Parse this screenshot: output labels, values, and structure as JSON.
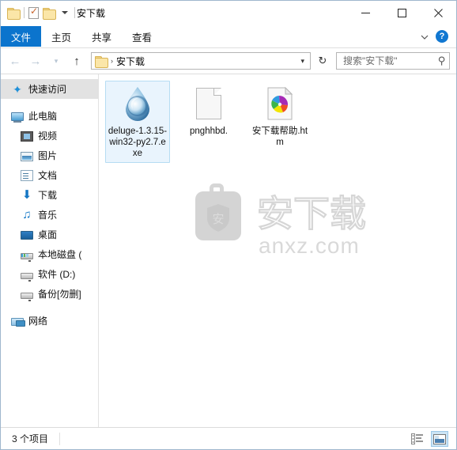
{
  "window": {
    "title": "安下载",
    "quick_access": [
      {
        "name": "folder-icon",
        "label": ""
      },
      {
        "name": "properties-icon",
        "label": ""
      },
      {
        "name": "folder-icon",
        "label": ""
      }
    ],
    "controls": {
      "minimize": "─",
      "maximize": "□",
      "close": "✕"
    }
  },
  "ribbon": {
    "tabs": [
      {
        "label": "文件",
        "active": true
      },
      {
        "label": "主页",
        "active": false
      },
      {
        "label": "共享",
        "active": false
      },
      {
        "label": "查看",
        "active": false
      }
    ],
    "expand_icon": "chevron-down-icon",
    "help_label": "?"
  },
  "address": {
    "back": "←",
    "forward": "→",
    "recent": "▾",
    "up": "↑",
    "crumb": "安下载",
    "crumb_separator": "›",
    "dropdown_caret": "▾",
    "refresh": "↻"
  },
  "search": {
    "placeholder": "搜索\"安下载\"",
    "value": "",
    "icon": "search-icon"
  },
  "sidebar": {
    "items": [
      {
        "label": "快速访问",
        "icon": "star-icon",
        "indent": 0,
        "selected": true,
        "gap_before": false
      },
      {
        "label": "此电脑",
        "icon": "computer-icon",
        "indent": 0,
        "selected": false,
        "gap_before": true
      },
      {
        "label": "视频",
        "icon": "videos-icon",
        "indent": 2,
        "selected": false,
        "gap_before": false
      },
      {
        "label": "图片",
        "icon": "pictures-icon",
        "indent": 2,
        "selected": false,
        "gap_before": false
      },
      {
        "label": "文档",
        "icon": "documents-icon",
        "indent": 2,
        "selected": false,
        "gap_before": false
      },
      {
        "label": "下载",
        "icon": "downloads-icon",
        "indent": 2,
        "selected": false,
        "gap_before": false
      },
      {
        "label": "音乐",
        "icon": "music-icon",
        "indent": 2,
        "selected": false,
        "gap_before": false
      },
      {
        "label": "桌面",
        "icon": "desktop-icon",
        "indent": 2,
        "selected": false,
        "gap_before": false
      },
      {
        "label": "本地磁盘 (",
        "icon": "system-drive-icon",
        "indent": 2,
        "selected": false,
        "gap_before": false
      },
      {
        "label": "软件 (D:)",
        "icon": "drive-icon",
        "indent": 2,
        "selected": false,
        "gap_before": false
      },
      {
        "label": "备份[勿删]",
        "icon": "drive-icon",
        "indent": 2,
        "selected": false,
        "gap_before": false
      },
      {
        "label": "网络",
        "icon": "network-icon",
        "indent": 0,
        "selected": false,
        "gap_before": true
      }
    ]
  },
  "files": [
    {
      "name": "deluge-1.3.15-win32-py2.7.exe",
      "icon": "deluge-droplet-icon",
      "selected": true
    },
    {
      "name": "pnghhbd.",
      "icon": "blank-page-icon",
      "selected": false
    },
    {
      "name": "安下载帮助.htm",
      "icon": "html-document-icon",
      "selected": false
    }
  ],
  "watermark": {
    "text": "安下载",
    "subtext": "anxz.com",
    "badge": "安"
  },
  "status": {
    "items_label": "3 个项目",
    "views": [
      {
        "name": "details-view",
        "active": false
      },
      {
        "name": "large-icons-view",
        "active": true
      }
    ]
  },
  "colors": {
    "accent": "#0b74cd",
    "selection_bg": "#e9f4fd",
    "selection_border": "#b6dcf3",
    "sidebar_selected": "#e2e2e2",
    "window_border": "#9fb6cd",
    "watermark_gray": "#d4d4d4"
  }
}
